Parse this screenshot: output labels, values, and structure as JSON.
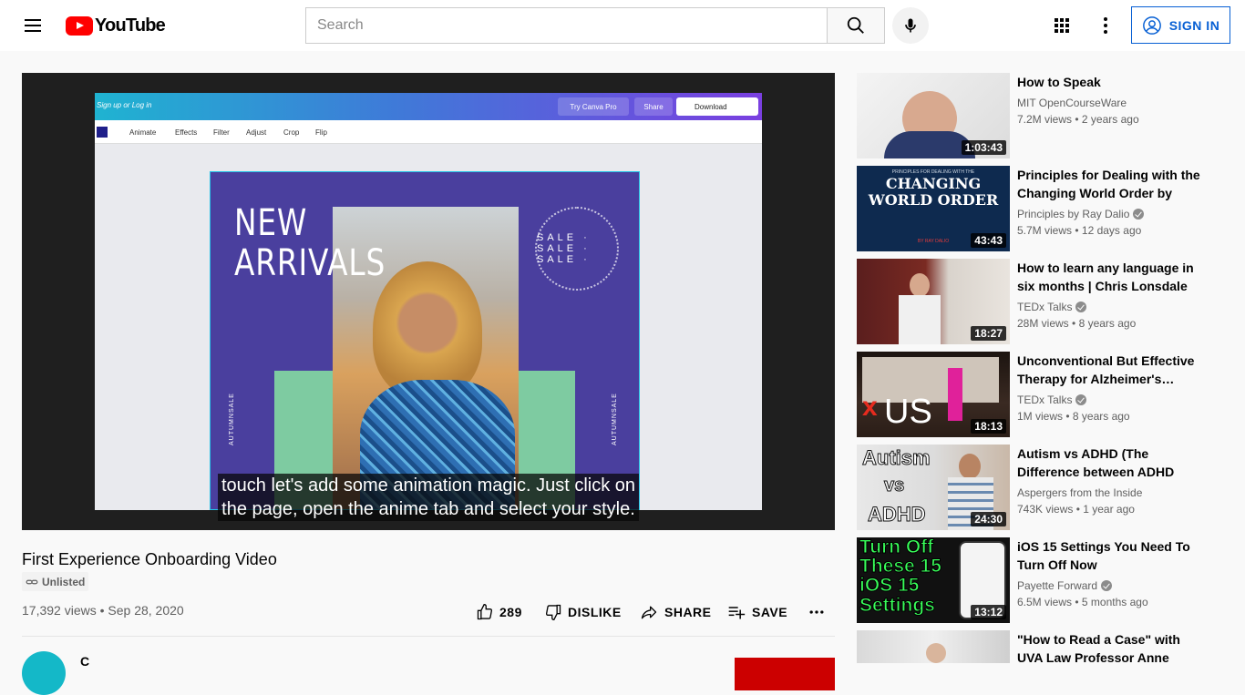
{
  "header": {
    "logo_text": "YouTube",
    "search_placeholder": "Search",
    "signin_label": "SIGN IN",
    "brand_color": "#ff0000",
    "accent_color": "#065fd4"
  },
  "player": {
    "caption_line1": "touch let's add some animation magic. Just click on",
    "caption_line2": "the page, open the anime tab and select your style.",
    "canva": {
      "top_link": "Sign up or Log in",
      "pro_label": "Try Canva Pro",
      "share_label": "Share",
      "download_label": "Download",
      "tools": [
        "Animate",
        "Effects",
        "Filter",
        "Adjust",
        "Crop",
        "Flip"
      ],
      "headline_1": "NEW",
      "headline_2": "ARRIVALS",
      "ring_text": "SALE · SALE · SALE ·",
      "vertical_text": "AUTUMNSALE"
    }
  },
  "video": {
    "title": "First Experience Onboarding Video",
    "badge": "Unlisted",
    "views": "17,392 views",
    "separator": "•",
    "date": "Sep 28, 2020",
    "like_count": "289",
    "dislike_label": "DISLIKE",
    "share_label": "SHARE",
    "save_label": "SAVE",
    "channel_initial": "C"
  },
  "related": [
    {
      "title": "How to Speak",
      "channel": "MIT OpenCourseWare",
      "verified": false,
      "views": "7.2M views",
      "age": "2 years ago",
      "duration": "1:03:43"
    },
    {
      "title": "Principles for Dealing with the Changing World Order by Ray…",
      "channel": "Principles by Ray Dalio",
      "verified": true,
      "views": "5.7M views",
      "age": "12 days ago",
      "duration": "43:43"
    },
    {
      "title": "How to learn any language in six months | Chris Lonsdale |…",
      "channel": "TEDx Talks",
      "verified": true,
      "views": "28M views",
      "age": "8 years ago",
      "duration": "18:27"
    },
    {
      "title": "Unconventional But Effective Therapy for Alzheimer's…",
      "channel": "TEDx Talks",
      "verified": true,
      "views": "1M views",
      "age": "8 years ago",
      "duration": "18:13"
    },
    {
      "title": "Autism vs ADHD (The Difference between ADHD and…",
      "channel": "Aspergers from the Inside",
      "verified": false,
      "views": "743K views",
      "age": "1 year ago",
      "duration": "24:30"
    },
    {
      "title": "iOS 15 Settings You Need To Turn Off Now",
      "channel": "Payette Forward",
      "verified": true,
      "views": "6.5M views",
      "age": "5 months ago",
      "duration": "13:12"
    },
    {
      "title": "\"How to Read a Case\" with UVA Law Professor Anne Coughlin",
      "channel": "",
      "verified": false,
      "views": "",
      "age": "",
      "duration": ""
    }
  ],
  "thumb_text": {
    "t2_line1": "PRINCIPLES FOR DEALING WITH THE",
    "t2_line2": "CHANGING",
    "t2_line3": "WORLD ORDER",
    "t2_line4": "BY RAY DALIO",
    "t4_text": "US",
    "t5_line1": "Autism",
    "t5_line2": "vs",
    "t5_line3": "ADHD",
    "t6_line1": "Turn Off",
    "t6_line2": "These 15",
    "t6_line3": "iOS 15",
    "t6_line4": "Settings"
  }
}
